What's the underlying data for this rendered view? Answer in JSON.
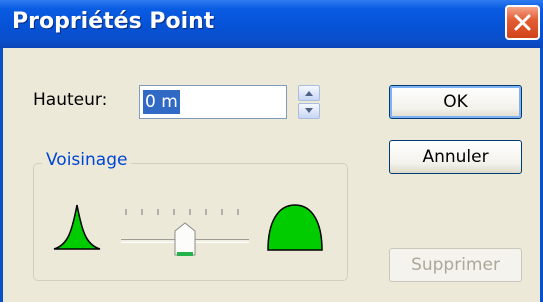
{
  "window": {
    "title": "Propriétés Point"
  },
  "height_field": {
    "label": "Hauteur:",
    "value": "0 m"
  },
  "group": {
    "title": "Voisinage"
  },
  "slider": {
    "ticks": 8,
    "position_index": 4
  },
  "buttons": {
    "ok": "OK",
    "cancel": "Annuler",
    "delete": "Supprimer"
  },
  "icons": {
    "close": "close-icon",
    "spin_up": "spin-up-icon",
    "spin_down": "spin-down-icon",
    "sharp_falloff": "sharp-peak-icon",
    "smooth_falloff": "smooth-dome-icon"
  },
  "colors": {
    "title_bar": "#0552D6",
    "dialog_bg": "#ECE9D8",
    "shape_fill": "#00CC00",
    "selection": "#316AC5",
    "group_title": "#0046D5"
  }
}
